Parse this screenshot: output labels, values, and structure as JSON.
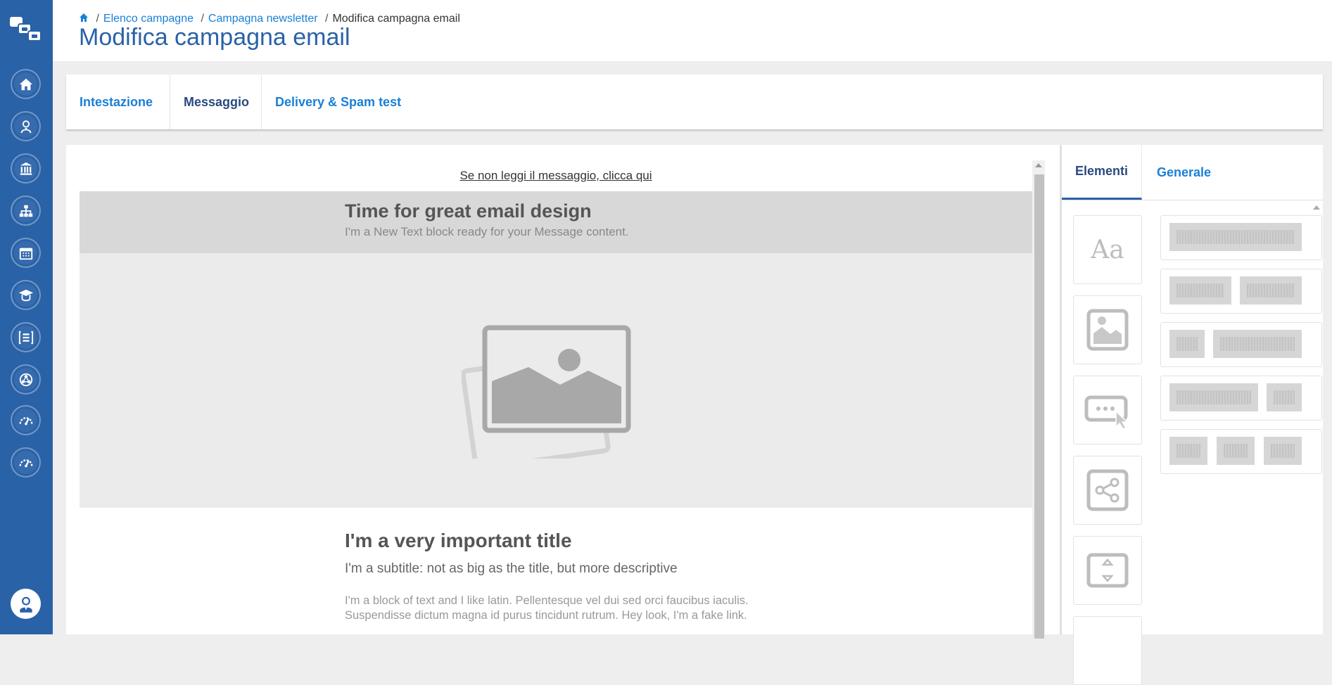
{
  "breadcrumb": {
    "items": [
      "Elenco campagne",
      "Campagna newsletter"
    ],
    "current": "Modifica campagna email",
    "separator": "/"
  },
  "page": {
    "title": "Modifica campagna email"
  },
  "tabs": [
    {
      "label": "Intestazione",
      "active": false
    },
    {
      "label": "Messaggio",
      "active": true
    },
    {
      "label": "Delivery & Spam test",
      "active": false
    }
  ],
  "email": {
    "view_online_link": "Se non leggi il messaggio, clicca qui",
    "hero": {
      "title": "Time for great email design",
      "subtitle": "I'm a New Text block ready for your Message content."
    },
    "content": {
      "title": "I'm a very important title",
      "subtitle": "I'm a subtitle: not as big as the title, but more descriptive",
      "body": "I'm a block of text and I like latin. Pellentesque vel dui sed orci faucibus iaculis. Suspendisse dictum magna id purus tincidunt rutrum. Hey look, I'm a fake link."
    }
  },
  "right_panel": {
    "tabs": [
      {
        "label": "Elementi",
        "active": true
      },
      {
        "label": "Generale",
        "active": false
      }
    ],
    "text_tool_glyph": "Aa",
    "tools": [
      "text-block-icon",
      "image-block-icon",
      "button-block-icon",
      "social-share-icon",
      "spacer-icon",
      "more-tool-icon"
    ],
    "layouts": [
      "one-column",
      "two-columns",
      "narrow-wide",
      "wide-narrow",
      "three-columns"
    ]
  },
  "sidebar": {
    "icons": [
      "home-icon",
      "user-icon",
      "institution-icon",
      "sitemap-icon",
      "calendar-icon",
      "graduation-icon",
      "list-icon",
      "network-icon",
      "gauge-icon",
      "dashboard-icon"
    ]
  },
  "colors": {
    "rail": "#2a62a8",
    "link": "#1a7fd6",
    "active_tab": "#2a4a7f"
  }
}
